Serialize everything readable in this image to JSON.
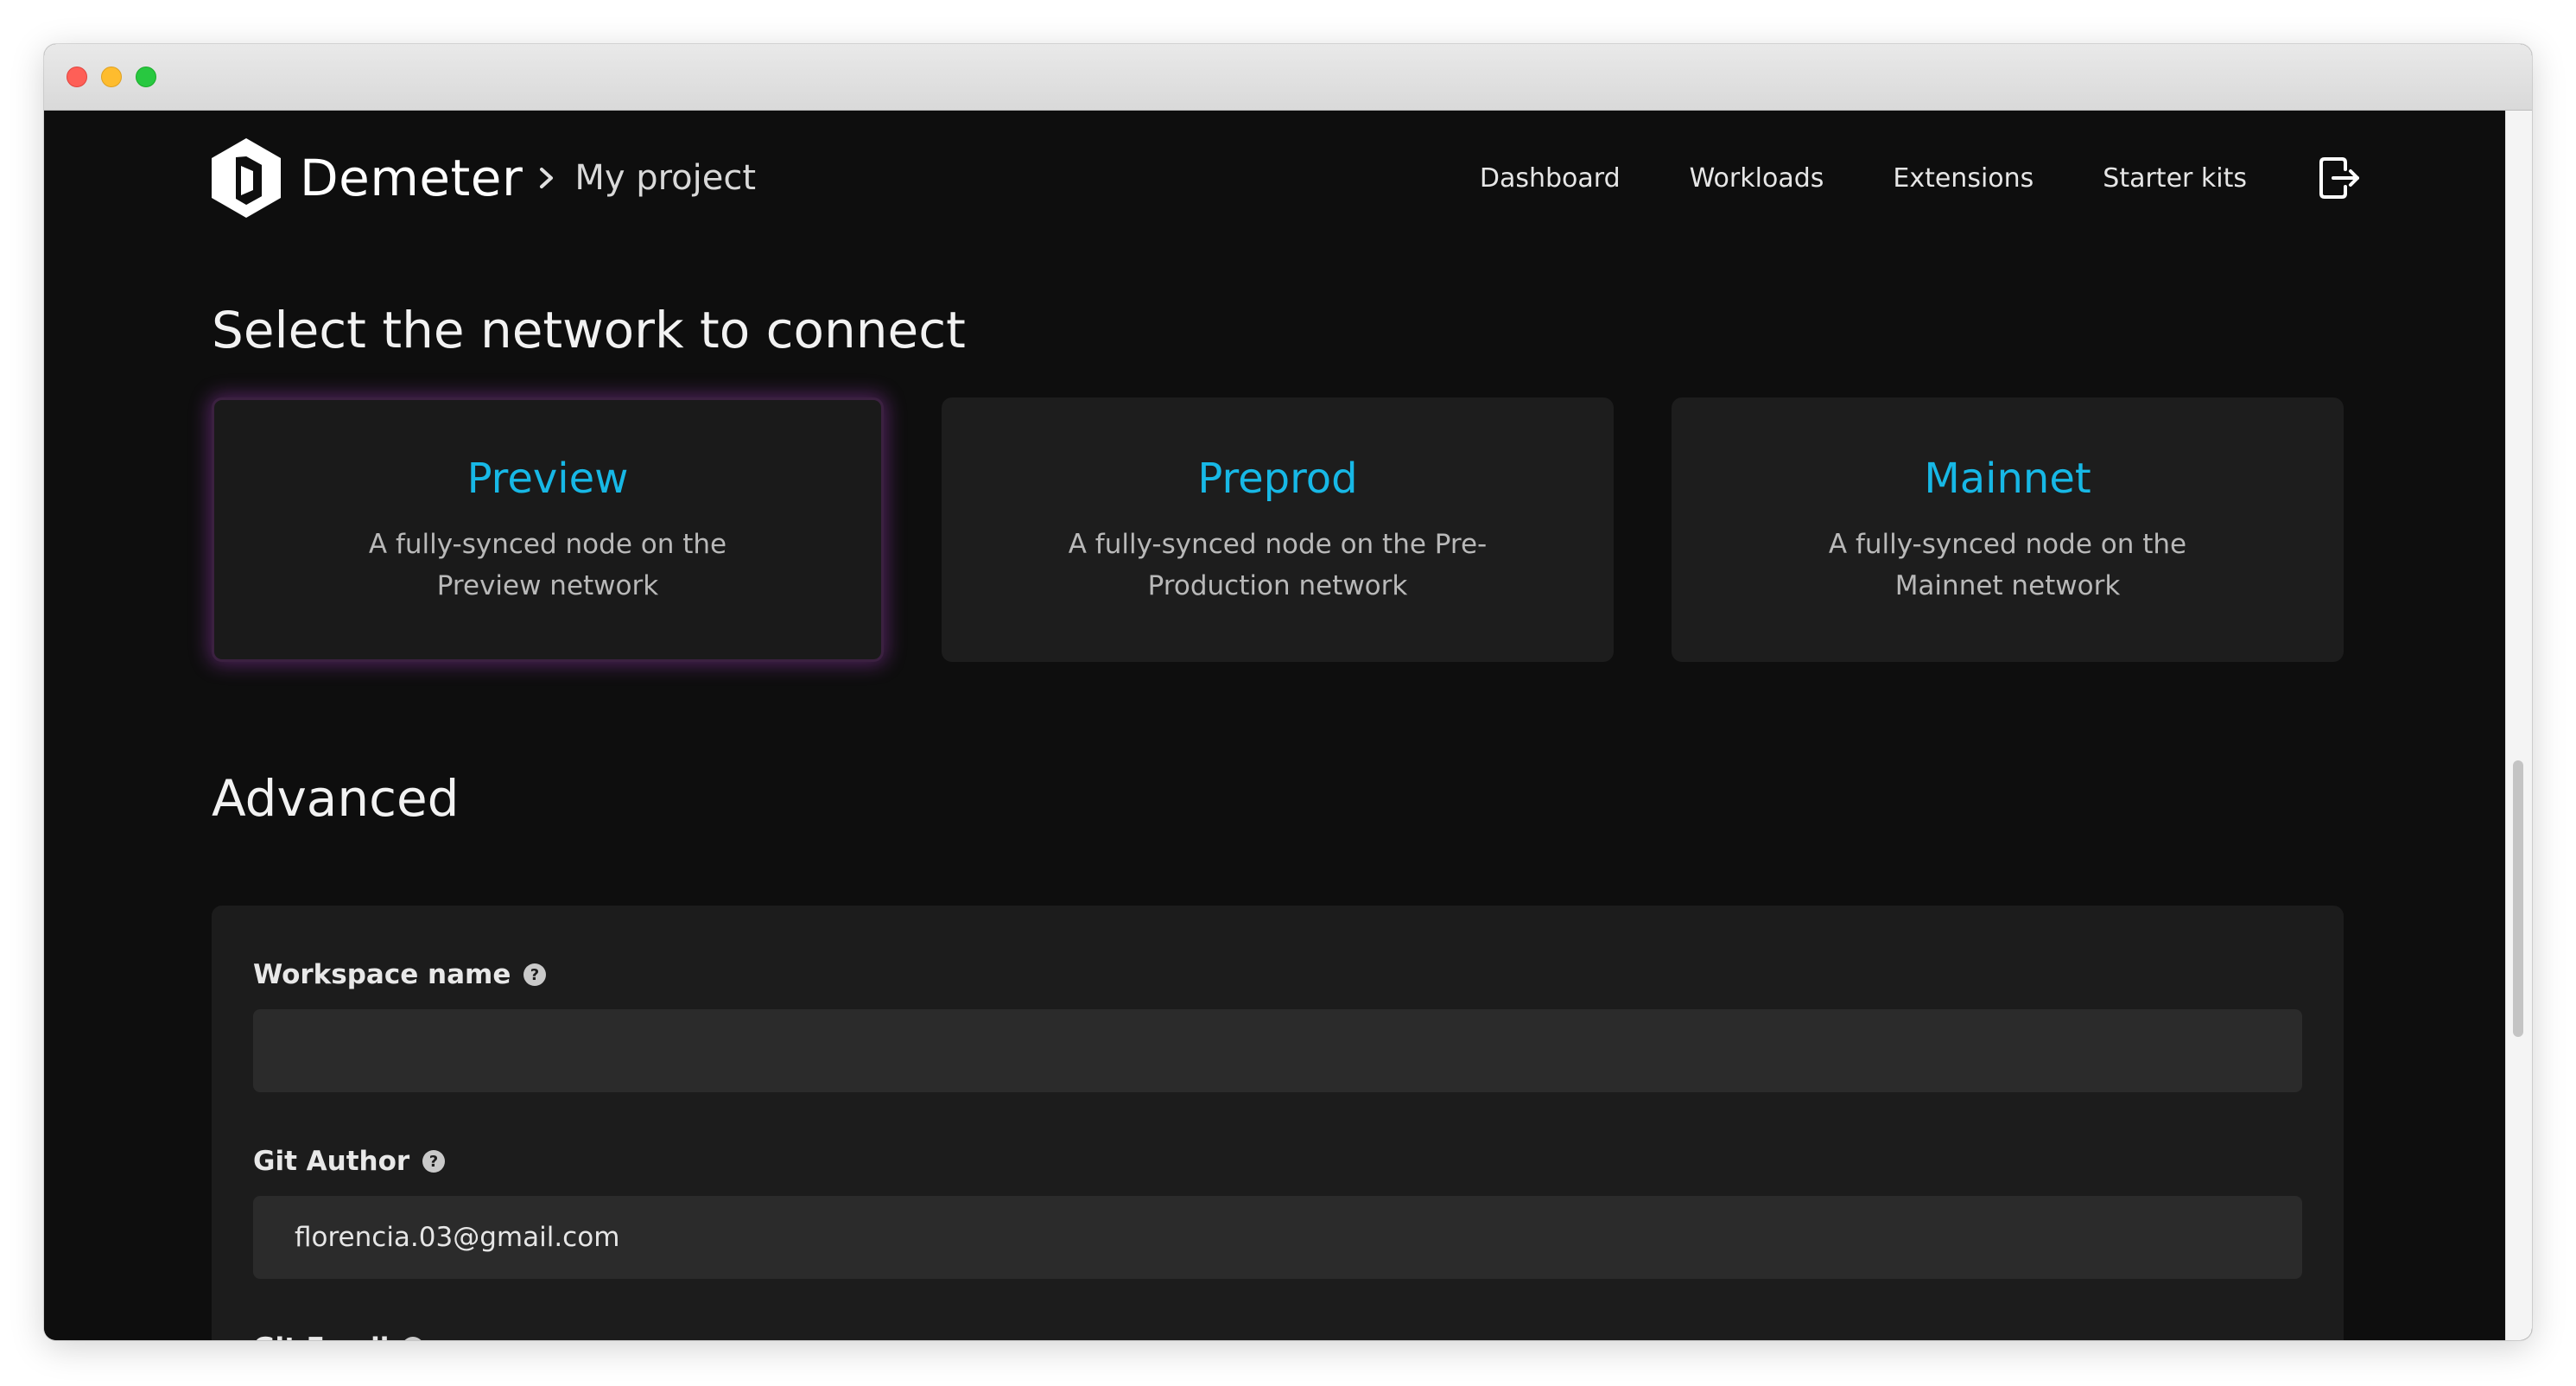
{
  "header": {
    "brand": "Demeter",
    "breadcrumb_project": "My project",
    "nav": [
      {
        "label": "Dashboard"
      },
      {
        "label": "Workloads"
      },
      {
        "label": "Extensions"
      },
      {
        "label": "Starter kits"
      }
    ],
    "logout_icon": "logout-icon"
  },
  "network_section": {
    "title": "Select the network to connect",
    "cards": [
      {
        "title": "Preview",
        "description": "A fully-synced node on the Preview network",
        "selected": true
      },
      {
        "title": "Preprod",
        "description": "A fully-synced node on the Pre-Production network",
        "selected": false
      },
      {
        "title": "Mainnet",
        "description": "A fully-synced node on the Mainnet network",
        "selected": false
      }
    ]
  },
  "advanced": {
    "title": "Advanced",
    "fields": [
      {
        "label": "Workspace name",
        "value": "",
        "placeholder": ""
      },
      {
        "label": "Git Author",
        "value": "florencia.03@gmail.com",
        "placeholder": ""
      },
      {
        "label": "Git Email",
        "value": "",
        "placeholder": ""
      }
    ]
  },
  "colors": {
    "accent": "#17b8e6",
    "page_background": "#0e0e0e",
    "card_background": "#1d1d1d",
    "selected_glow": "#983ab4",
    "input_background": "#2b2b2b"
  }
}
